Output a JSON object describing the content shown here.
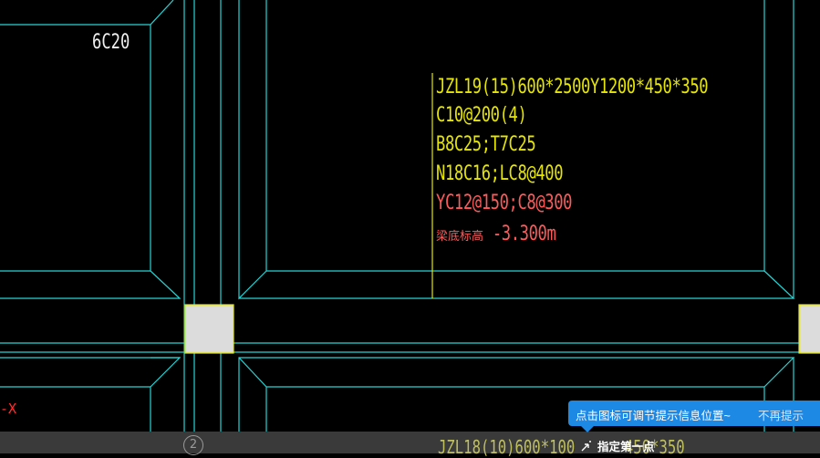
{
  "app": {
    "title": ""
  },
  "drawing": {
    "annotations": {
      "rebar_top_left": "6C20",
      "beam_spec_lines": [
        "JZL19(15)600*2500Y1200*450*350",
        "C10@200(4)",
        "B8C25;T7C25",
        "N18C16;LC8@400"
      ],
      "extra_line": "YC12@150;C8@300",
      "elevation_label": "梁底标高",
      "elevation_value": "-3.300m",
      "bottom_beam_spec": "JZL18(10)600*100",
      "bottom_beam_spec_tail": "450*350",
      "axis_marker": "-X",
      "grid_bubble": "2"
    },
    "colors": {
      "background": "#000000",
      "beam_lines": "#26d4d4",
      "annotation_yellow": "#e6e600",
      "annotation_red": "#ff5a5a",
      "column_fill": "#dcdcdc",
      "column_border": "#e6e600"
    }
  },
  "tooltip": {
    "message": "点击图标可调节提示信息位置~",
    "dismiss_label": "不再提示",
    "color": "#1e88e5"
  },
  "command_prompt": {
    "icon": "crosshair-cursor-icon",
    "text": "指定第一点"
  }
}
